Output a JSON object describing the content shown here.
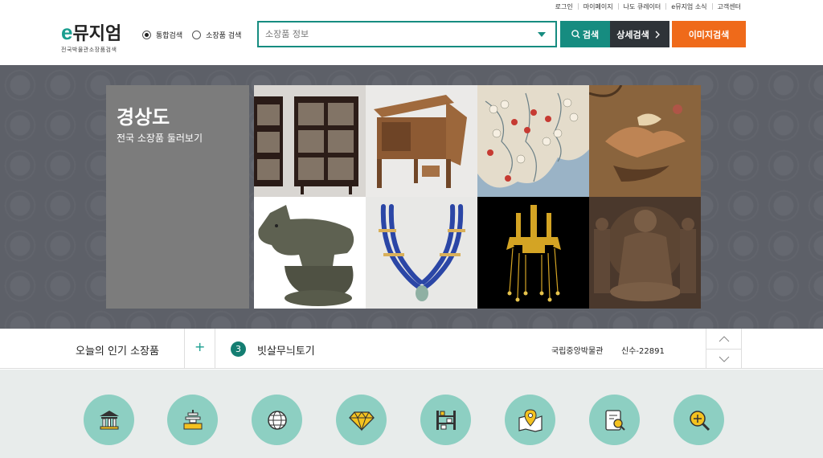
{
  "util_links": [
    "로그인",
    "마이페이지",
    "나도 큐레이터",
    "e뮤지엄 소식",
    "고객센터"
  ],
  "logo": {
    "e": "e",
    "name": "뮤지엄",
    "sub": "전국박물관소장품검색"
  },
  "search_type": {
    "options": [
      "통합검색",
      "소장품 검색"
    ],
    "selected": "통합검색"
  },
  "search": {
    "placeholder": "소장품 정보"
  },
  "buttons": {
    "search": "검색",
    "detail": "상세검색",
    "image": "이미지검색"
  },
  "hero": {
    "region": "경상도",
    "subtitle": "전국 소장품 둘러보기",
    "tiles": [
      "lacquer-cabinet",
      "wooden-winnowing-machine",
      "old-map",
      "bird-painting",
      "animal-figure",
      "blue-bead-necklace",
      "gold-crown-ornament",
      "buddha-relief"
    ]
  },
  "popular": {
    "title": "오늘의 인기 소장품",
    "rank": "3",
    "item": "빗살무늬토기",
    "museum": "국립중앙박물관",
    "code": "신수-22891"
  },
  "categories": [
    "museum-icon",
    "pagoda-icon",
    "globe-icon",
    "gem-icon",
    "shelf-icon",
    "map-pin-icon",
    "document-search-icon",
    "zoom-in-icon"
  ],
  "colors": {
    "accent": "#1a9e8f",
    "orange": "#ef6a1a",
    "dark": "#2e3338",
    "circle": "#8dcfc2"
  }
}
